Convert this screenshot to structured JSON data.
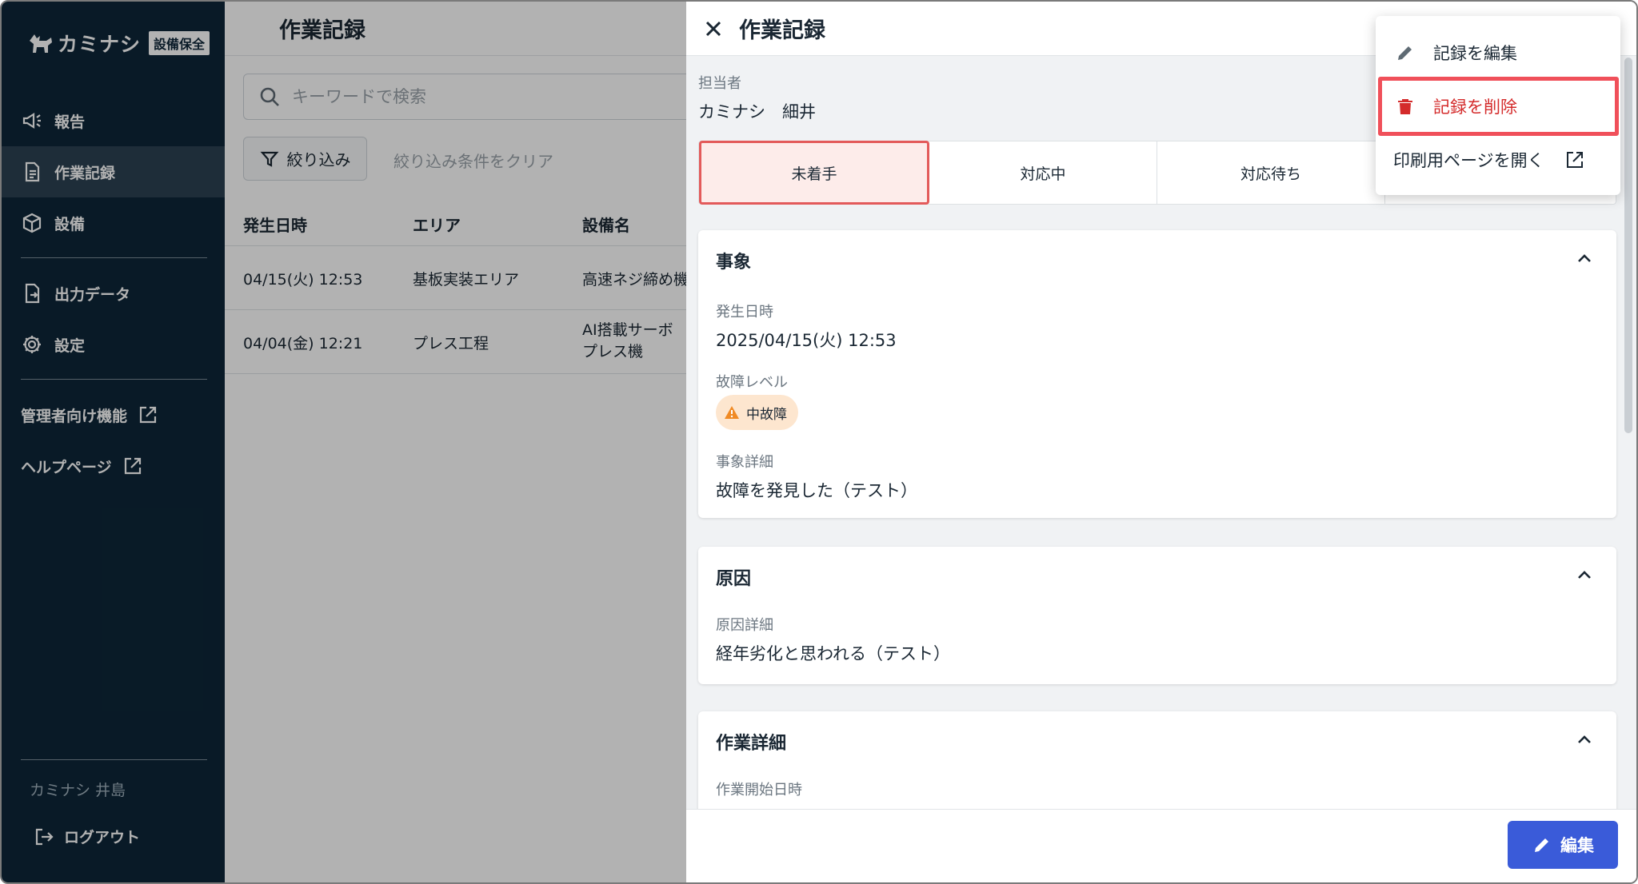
{
  "app": {
    "logo_name": "カミナシ",
    "logo_badge": "設備保全"
  },
  "sidebar": {
    "items": [
      {
        "label": "報告",
        "icon": "megaphone-icon"
      },
      {
        "label": "作業記録",
        "icon": "document-icon",
        "active": true
      },
      {
        "label": "設備",
        "icon": "box-icon"
      },
      {
        "label": "出力データ",
        "icon": "file-export-icon"
      },
      {
        "label": "設定",
        "icon": "gear-icon"
      }
    ],
    "external_links": [
      {
        "label": "管理者向け機能",
        "icon": "external-link-icon"
      },
      {
        "label": "ヘルプページ",
        "icon": "external-link-icon"
      }
    ],
    "user_name": "カミナシ 井島",
    "logout_label": "ログアウト"
  },
  "main": {
    "title": "作業記録",
    "search_placeholder": "キーワードで検索",
    "filter_label": "絞り込み",
    "clear_filter_label": "絞り込み条件をクリア",
    "columns": [
      "発生日時",
      "エリア",
      "設備名"
    ],
    "rows": [
      {
        "datetime": "04/15(火) 12:53",
        "area": "基板実装エリア",
        "equipment": "高速ネジ締め機"
      },
      {
        "datetime": "04/04(金) 12:21",
        "area": "プレス工程",
        "equipment": "AI搭載サーボプレス機"
      }
    ]
  },
  "detail": {
    "title": "作業記録",
    "assignee_label": "担当者",
    "assignee_value": "カミナシ　細井",
    "status_tabs": [
      "未着手",
      "対応中",
      "対応待ち"
    ],
    "active_status": "未着手",
    "sections": {
      "event": {
        "title": "事象",
        "occurred_label": "発生日時",
        "occurred_value": "2025/04/15(火) 12:53",
        "level_label": "故障レベル",
        "level_value": "中故障",
        "detail_label": "事象詳細",
        "detail_value": "故障を発見した（テスト）"
      },
      "cause": {
        "title": "原因",
        "detail_label": "原因詳細",
        "detail_value": "経年劣化と思われる（テスト）"
      },
      "work": {
        "title": "作業詳細",
        "start_label": "作業開始日時"
      }
    },
    "edit_button_label": "編集"
  },
  "menu": {
    "items": [
      {
        "label": "記録を編集",
        "icon": "pencil-icon"
      },
      {
        "label": "記録を削除",
        "icon": "trash-icon",
        "danger": true,
        "highlighted": true
      },
      {
        "label": "印刷用ページを開く",
        "icon": "external-link-icon"
      }
    ]
  },
  "colors": {
    "sidebar_bg": "#0d2638",
    "primary": "#3a5bd9",
    "danger": "#d42b2b",
    "highlight_border": "#f0505a",
    "warning": "#f08a24"
  }
}
